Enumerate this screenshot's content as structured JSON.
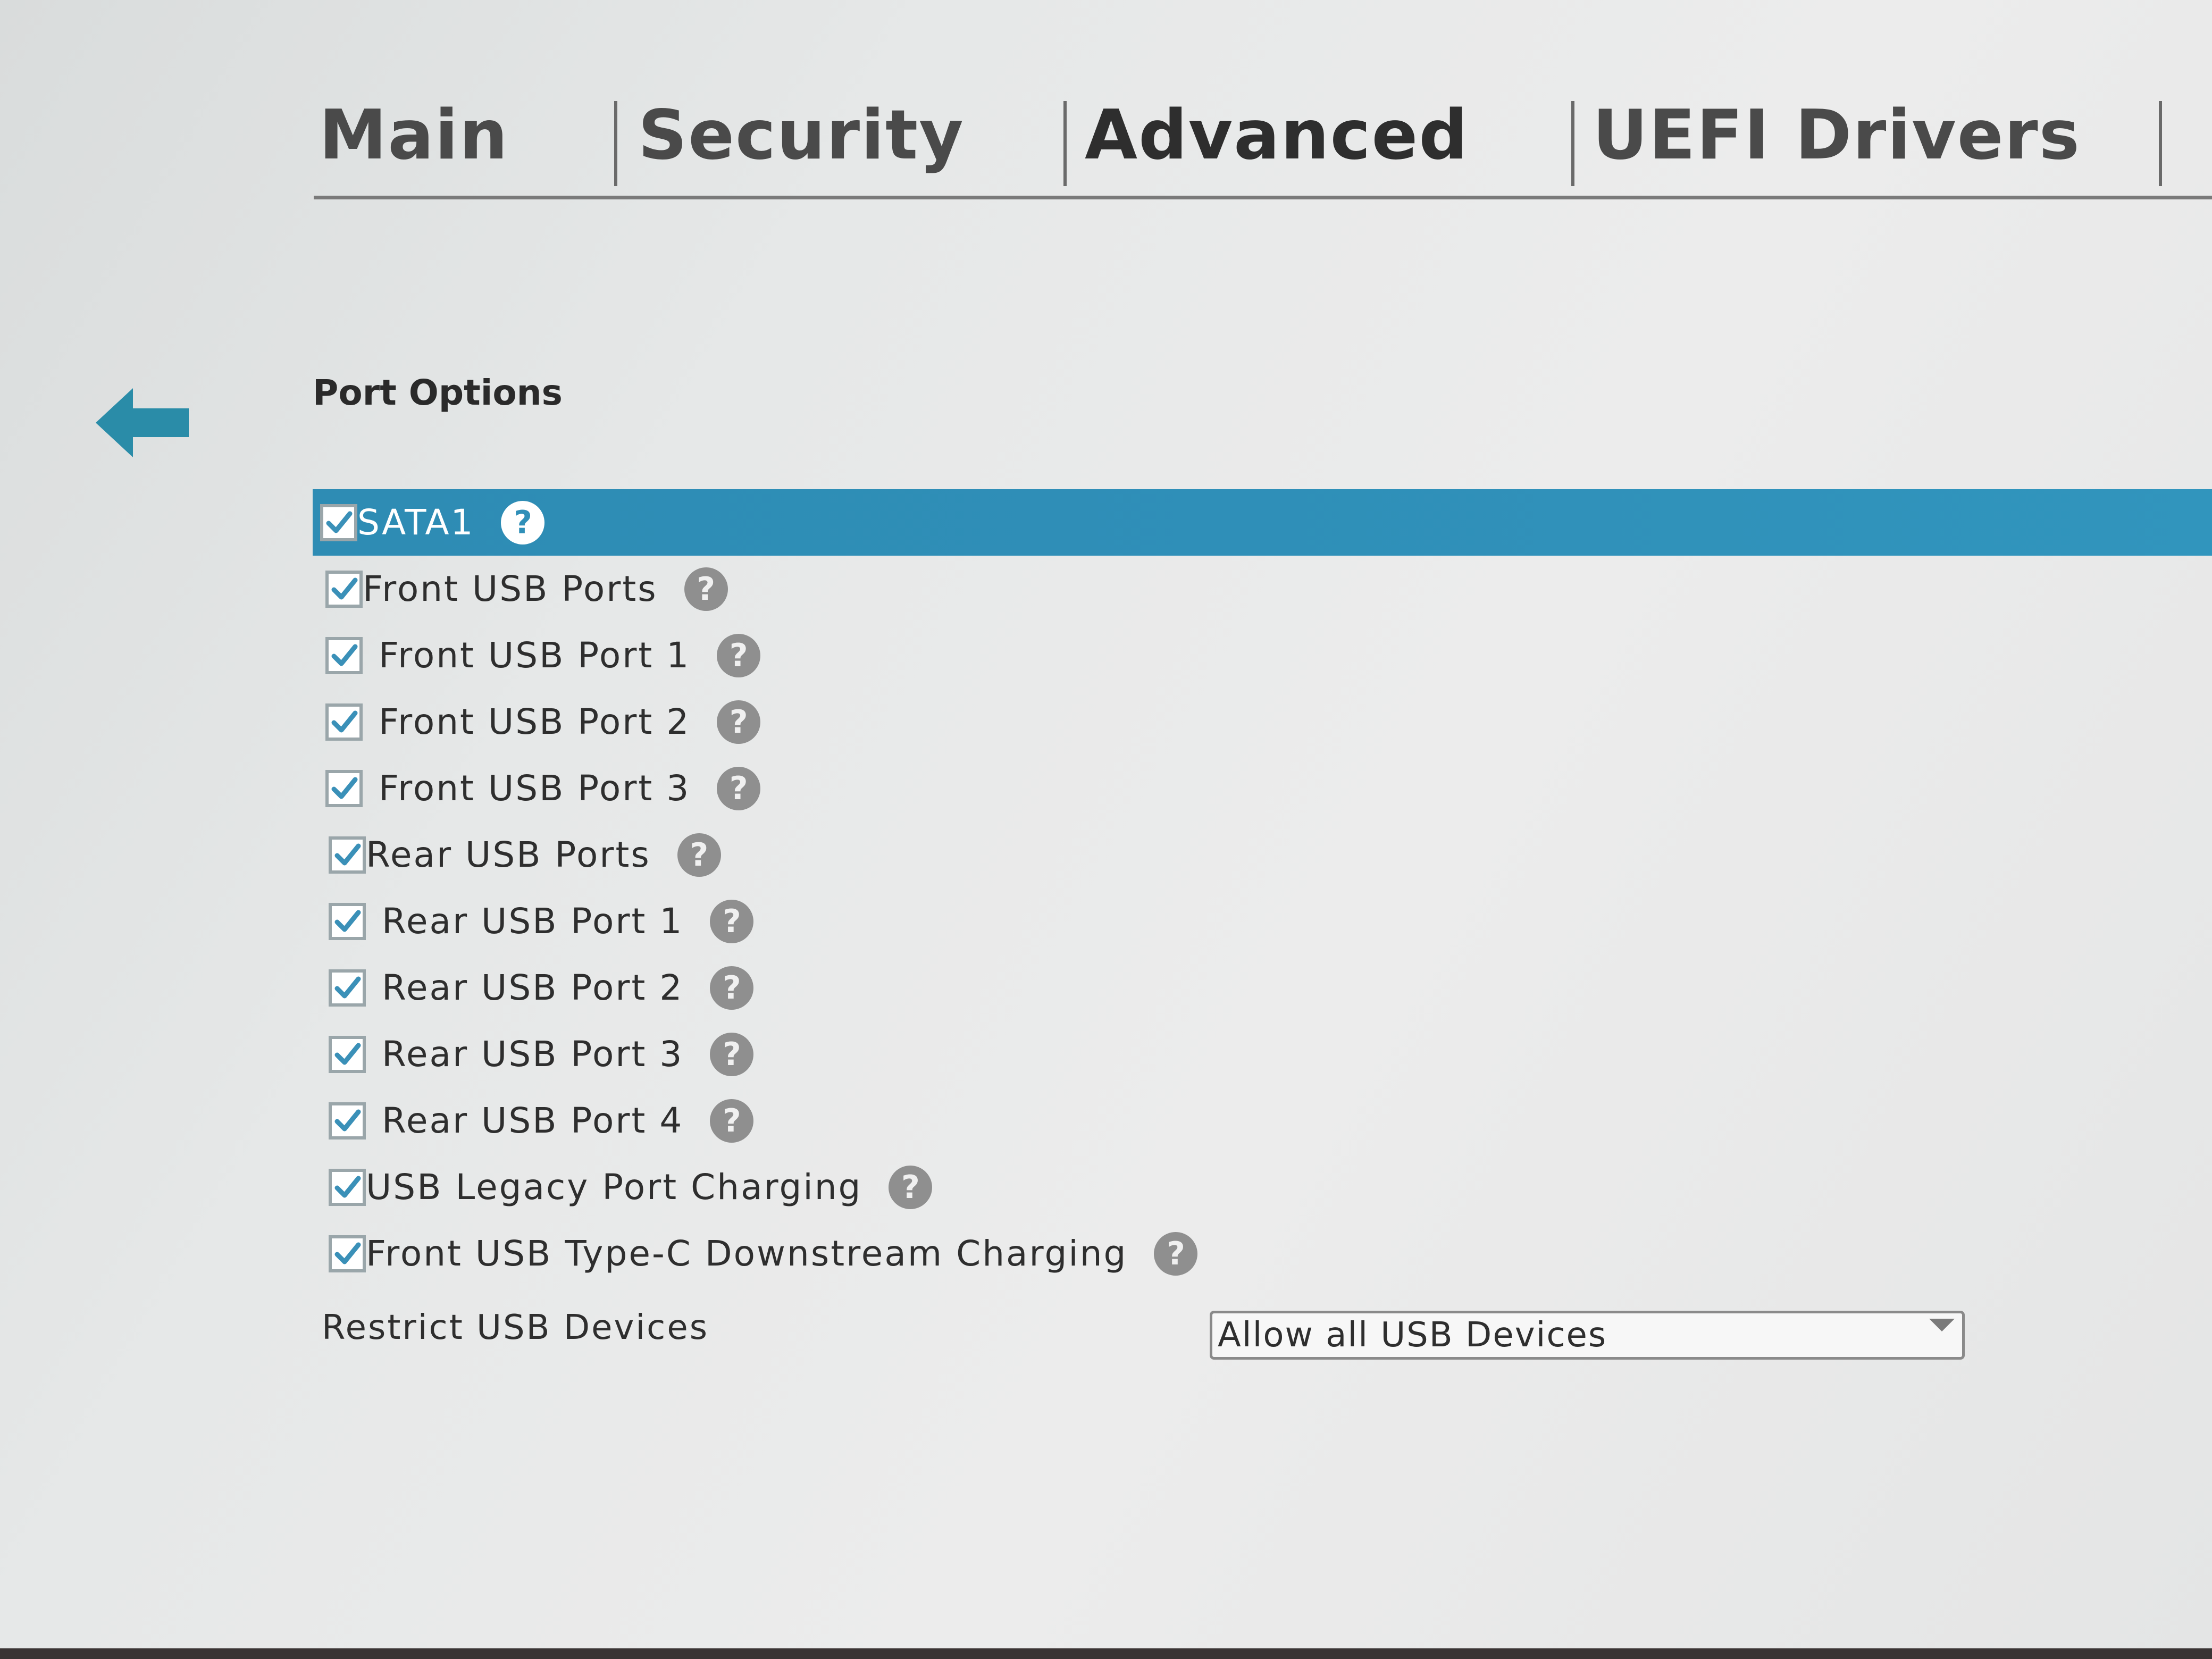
{
  "tabs": [
    {
      "label": "Main"
    },
    {
      "label": "Security"
    },
    {
      "label": "Advanced"
    },
    {
      "label": "UEFI Drivers"
    }
  ],
  "active_tab": "Advanced",
  "section": {
    "title": "Port Options"
  },
  "options": [
    {
      "label": "SATA1",
      "checked": true,
      "selected": true
    },
    {
      "label": "Front USB Ports",
      "checked": true
    },
    {
      "label": "Front USB Port 1",
      "checked": true
    },
    {
      "label": "Front USB Port 2",
      "checked": true
    },
    {
      "label": "Front USB Port 3",
      "checked": true
    },
    {
      "label": "Rear USB Ports",
      "checked": true
    },
    {
      "label": "Rear USB Port 1",
      "checked": true
    },
    {
      "label": "Rear USB Port 2",
      "checked": true
    },
    {
      "label": "Rear USB Port 3",
      "checked": true
    },
    {
      "label": "Rear USB Port 4",
      "checked": true
    },
    {
      "label": "USB Legacy Port Charging",
      "checked": true
    },
    {
      "label": "Front USB Type-C Downstream Charging",
      "checked": true
    }
  ],
  "restrict": {
    "label": "Restrict USB Devices",
    "value": "Allow all USB Devices"
  },
  "help_glyph": "?",
  "icons": {
    "back": "back-arrow-icon",
    "help": "help-icon",
    "check": "checkmark-icon",
    "dropdown": "chevron-down-icon"
  },
  "colors": {
    "accent": "#2f8fb8",
    "arrow": "#2a8ca8",
    "check": "#3a90b8",
    "help": "#8f8f8f"
  }
}
